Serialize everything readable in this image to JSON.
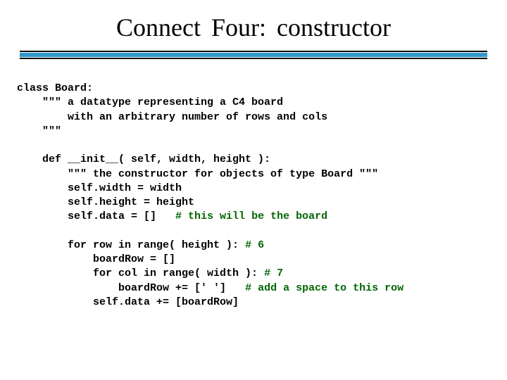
{
  "title": "Connect Four:    constructor",
  "code": {
    "l01a": "class Board:",
    "l02a": "    \"\"\" a datatype representing a C4 board",
    "l03a": "        with an arbitrary number of rows and cols",
    "l04a": "    \"\"\"",
    "l05a": "",
    "l06a": "    def __init__( self, width, height ):",
    "l07a": "        \"\"\" the constructor for objects of type Board \"\"\"",
    "l08a": "        self.width = width",
    "l09a": "        self.height = height",
    "l10a": "        self.data = []   ",
    "l10b": "# this will be the board",
    "l11a": "",
    "l12a": "        for row in range( height ): ",
    "l12b": "# 6",
    "l13a": "            boardRow = []",
    "l14a": "            for col in range( width ): ",
    "l14b": "# 7",
    "l15a": "                boardRow += [' ']   ",
    "l15b": "# add a space to this row",
    "l16a": "            self.data += [boardRow]"
  }
}
